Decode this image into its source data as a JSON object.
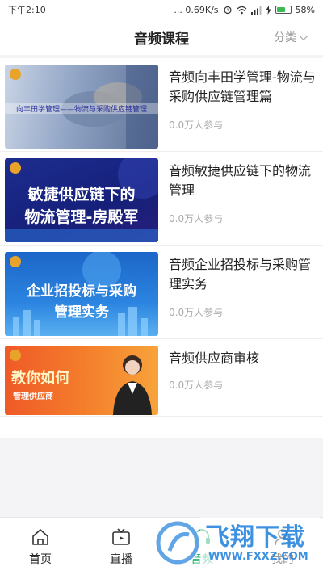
{
  "status": {
    "time": "下午2:10",
    "network": "... 0.69K/s",
    "battery": "58%"
  },
  "header": {
    "title": "音频课程",
    "filter_label": "分类"
  },
  "courses": [
    {
      "title": "音频向丰田学管理-物流与采购供应链管理篇",
      "meta": "0.0万人参与",
      "thumb_text": "向丰田学管理——物流与采购供应链管理"
    },
    {
      "title": "音频敏捷供应链下的物流管理",
      "meta": "0.0万人参与",
      "thumb_line1": "敏捷供应链下的",
      "thumb_line2": "物流管理-房殿军"
    },
    {
      "title": "音频企业招投标与采购管理实务",
      "meta": "0.0万人参与",
      "thumb_line1": "企业招投标与采购",
      "thumb_line2": "管理实务"
    },
    {
      "title": "音频供应商审核",
      "meta": "0.0万人参与",
      "thumb_line1": "教你如何",
      "thumb_line2": "管理供应商"
    }
  ],
  "tabs": [
    {
      "label": "首页",
      "icon": "home-icon"
    },
    {
      "label": "直播",
      "icon": "tv-icon"
    },
    {
      "label": "音频",
      "icon": "audio-icon"
    },
    {
      "label": "我的",
      "icon": "user-icon"
    }
  ],
  "watermark": {
    "text": "飞翔下载",
    "url": "WWW.FXXZ.COM"
  },
  "colors": {
    "accent": "#2bb673",
    "muted": "#aaaaaa"
  }
}
